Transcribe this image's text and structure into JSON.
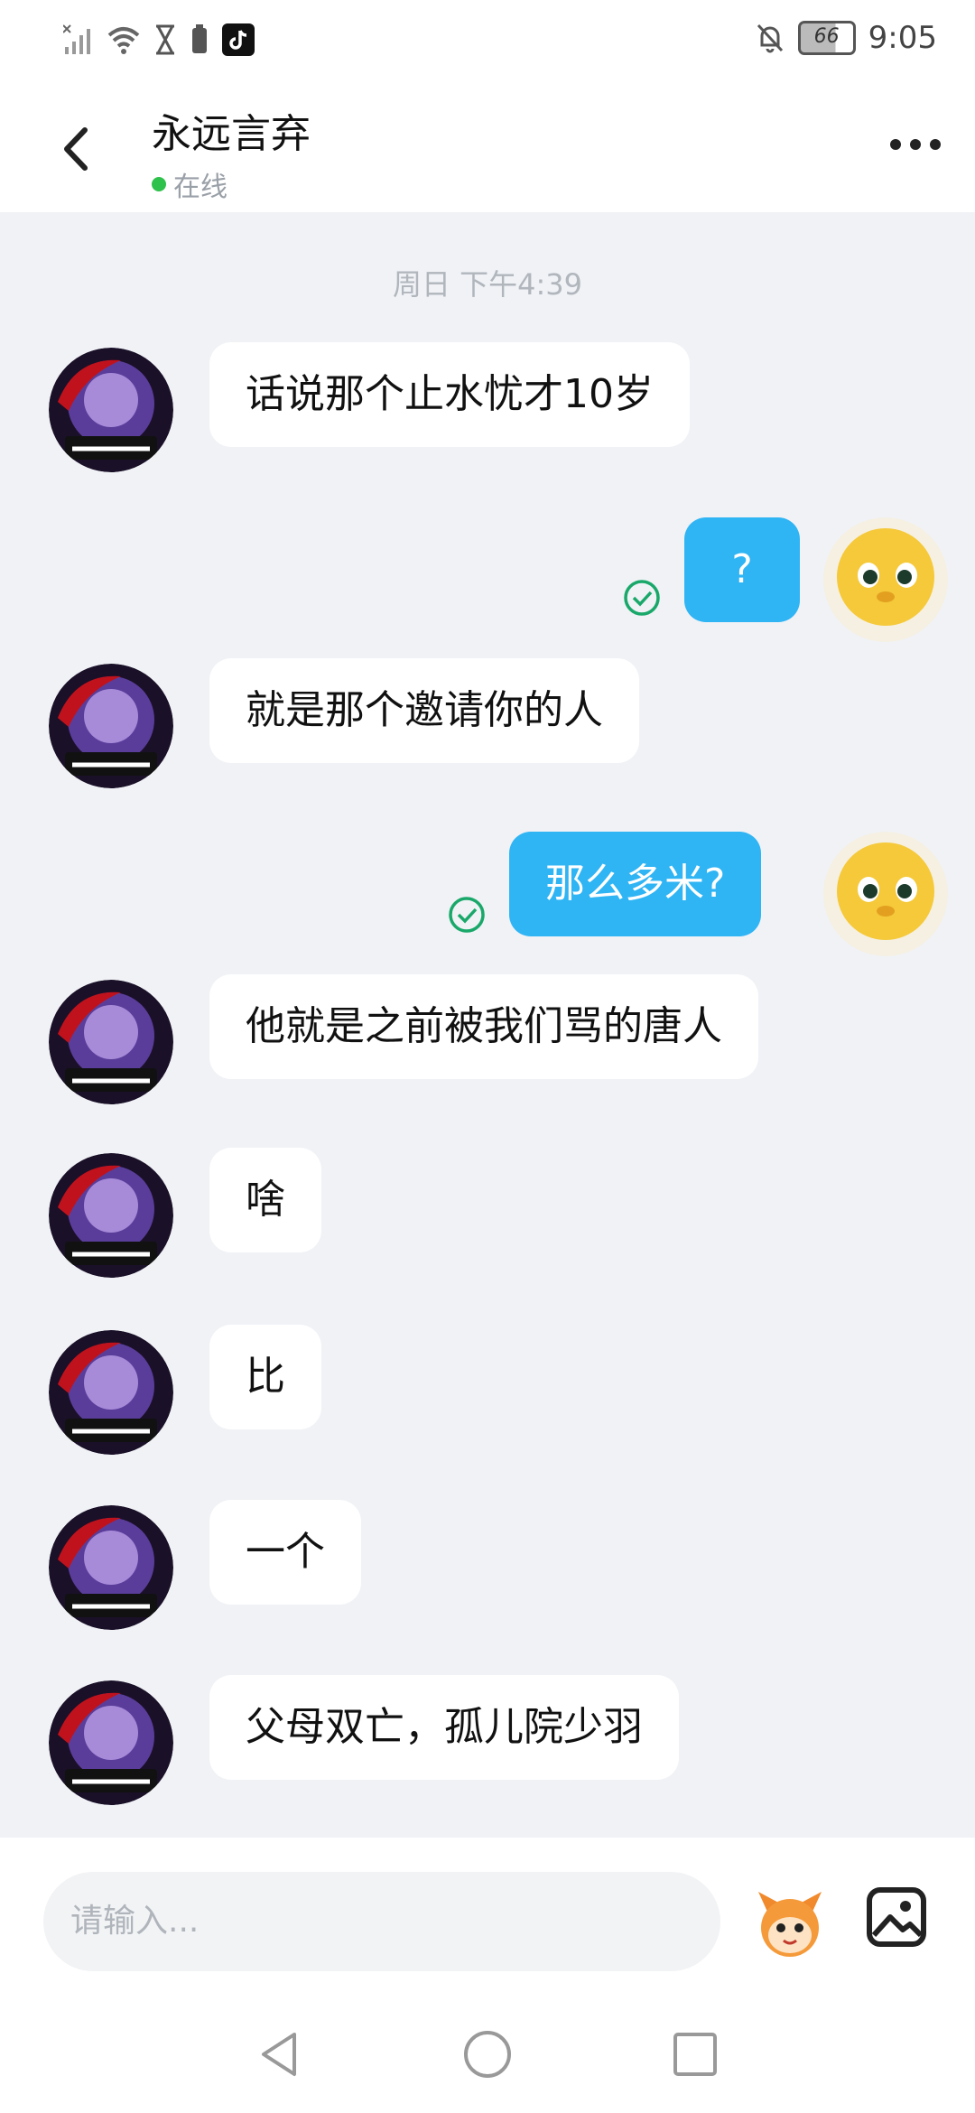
{
  "status_bar": {
    "battery": "66",
    "time": "9:05",
    "icons": [
      "signal-icon",
      "wifi-icon",
      "hourglass-icon",
      "battery-saver-icon",
      "tiktok-icon",
      "mute-bell-icon"
    ]
  },
  "header": {
    "title": "永远言弃",
    "status": "在线",
    "back_icon": "chevron-left-icon",
    "more_icon": "more-dots-icon"
  },
  "chat": {
    "timestamp": "周日 下午4:39",
    "messages": [
      {
        "side": "in",
        "text": "话说那个止水忧才10岁"
      },
      {
        "side": "out",
        "text": "?"
      },
      {
        "side": "in",
        "text": "就是那个邀请你的人"
      },
      {
        "side": "out",
        "text": "那么多米?"
      },
      {
        "side": "in",
        "text": "他就是之前被我们骂的唐人"
      },
      {
        "side": "in",
        "text": "啥"
      },
      {
        "side": "in",
        "text": "比"
      },
      {
        "side": "in",
        "text": "一个"
      },
      {
        "side": "in",
        "text": "父母双亡，孤儿院少羽"
      }
    ]
  },
  "input_bar": {
    "placeholder": "请输入...",
    "emoji_icon": "mascot-emoji-icon",
    "image_icon": "image-icon"
  },
  "nav_bar": {
    "icons": [
      "back-triangle-icon",
      "home-circle-icon",
      "recents-square-icon"
    ]
  },
  "colors": {
    "accent": "#2fb4f4",
    "online": "#2ec14b",
    "background": "#f0f2f6"
  }
}
